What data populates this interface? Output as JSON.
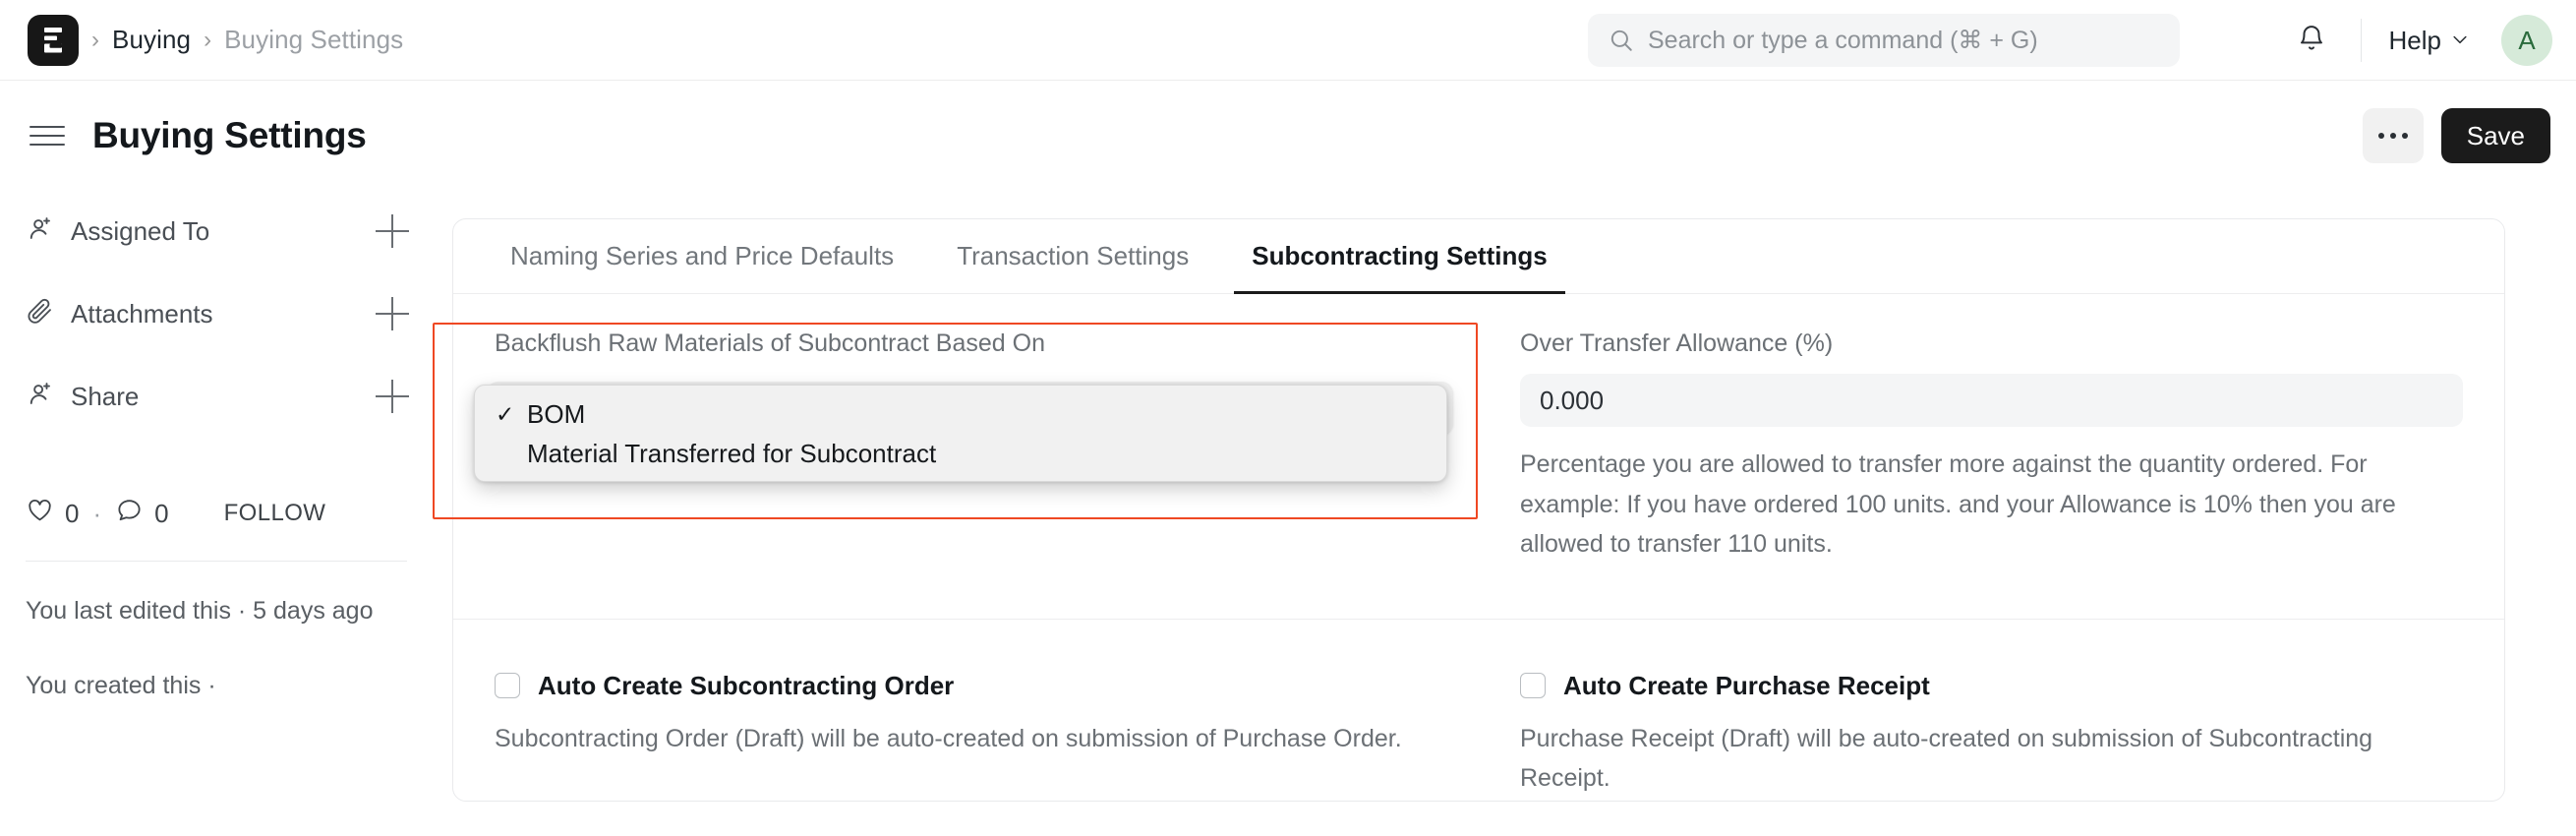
{
  "navbar": {
    "logo_icon": "erpnext-logo-icon",
    "breadcrumbs": [
      {
        "label": "Buying",
        "muted": false
      },
      {
        "label": "Buying Settings",
        "muted": true
      }
    ],
    "separator": "›",
    "search": {
      "icon": "search-icon",
      "placeholder": "Search or type a command (⌘ + G)",
      "value": ""
    },
    "notifications_icon": "bell-icon",
    "help_label": "Help",
    "help_chevron_icon": "chevron-down-icon",
    "avatar_initial": "A",
    "avatar_bg": "#d6ead9",
    "avatar_fg": "#2a6b3c"
  },
  "page_head": {
    "menu_icon": "hamburger-menu-icon",
    "title": "Buying Settings",
    "more_label": "···",
    "save_label": "Save"
  },
  "sidebar": {
    "items": [
      {
        "label": "Assigned To",
        "icon": "user-plus-icon",
        "action_icon": "plus-icon"
      },
      {
        "label": "Attachments",
        "icon": "paperclip-icon",
        "action_icon": "plus-icon"
      },
      {
        "label": "Share",
        "icon": "user-plus-icon",
        "action_icon": "plus-icon"
      }
    ],
    "stats": {
      "like_icon": "heart-icon",
      "like_count": "0",
      "separator": "·",
      "comment_icon": "comment-icon",
      "comment_count": "0",
      "follow_label": "FOLLOW"
    },
    "notes": [
      "You last edited this · 5 days ago",
      "You created this ·"
    ]
  },
  "main": {
    "tabs": [
      {
        "label": "Naming Series and Price Defaults",
        "active": false
      },
      {
        "label": "Transaction Settings",
        "active": false
      },
      {
        "label": "Subcontracting Settings",
        "active": true
      }
    ],
    "backflush": {
      "label": "Backflush Raw Materials of Subcontract Based On",
      "selected_value": "BOM",
      "options": [
        {
          "label": "BOM",
          "checked": true
        },
        {
          "label": "Material Transferred for Subcontract",
          "checked": false
        }
      ],
      "highlight_color": "#ef4823"
    },
    "over_transfer": {
      "label": "Over Transfer Allowance (%)",
      "value": "0.000",
      "help": "Percentage you are allowed to transfer more against the quantity ordered. For example: If you have ordered 100 units. and your Allowance is 10% then you are allowed to transfer 110 units."
    },
    "auto_subcontracting_order": {
      "label": "Auto Create Subcontracting Order",
      "checked": false,
      "help": "Subcontracting Order (Draft) will be auto-created on submission of Purchase Order."
    },
    "auto_purchase_receipt": {
      "label": "Auto Create Purchase Receipt",
      "checked": false,
      "help": "Purchase Receipt (Draft) will be auto-created on submission of Subcontracting Receipt."
    }
  }
}
